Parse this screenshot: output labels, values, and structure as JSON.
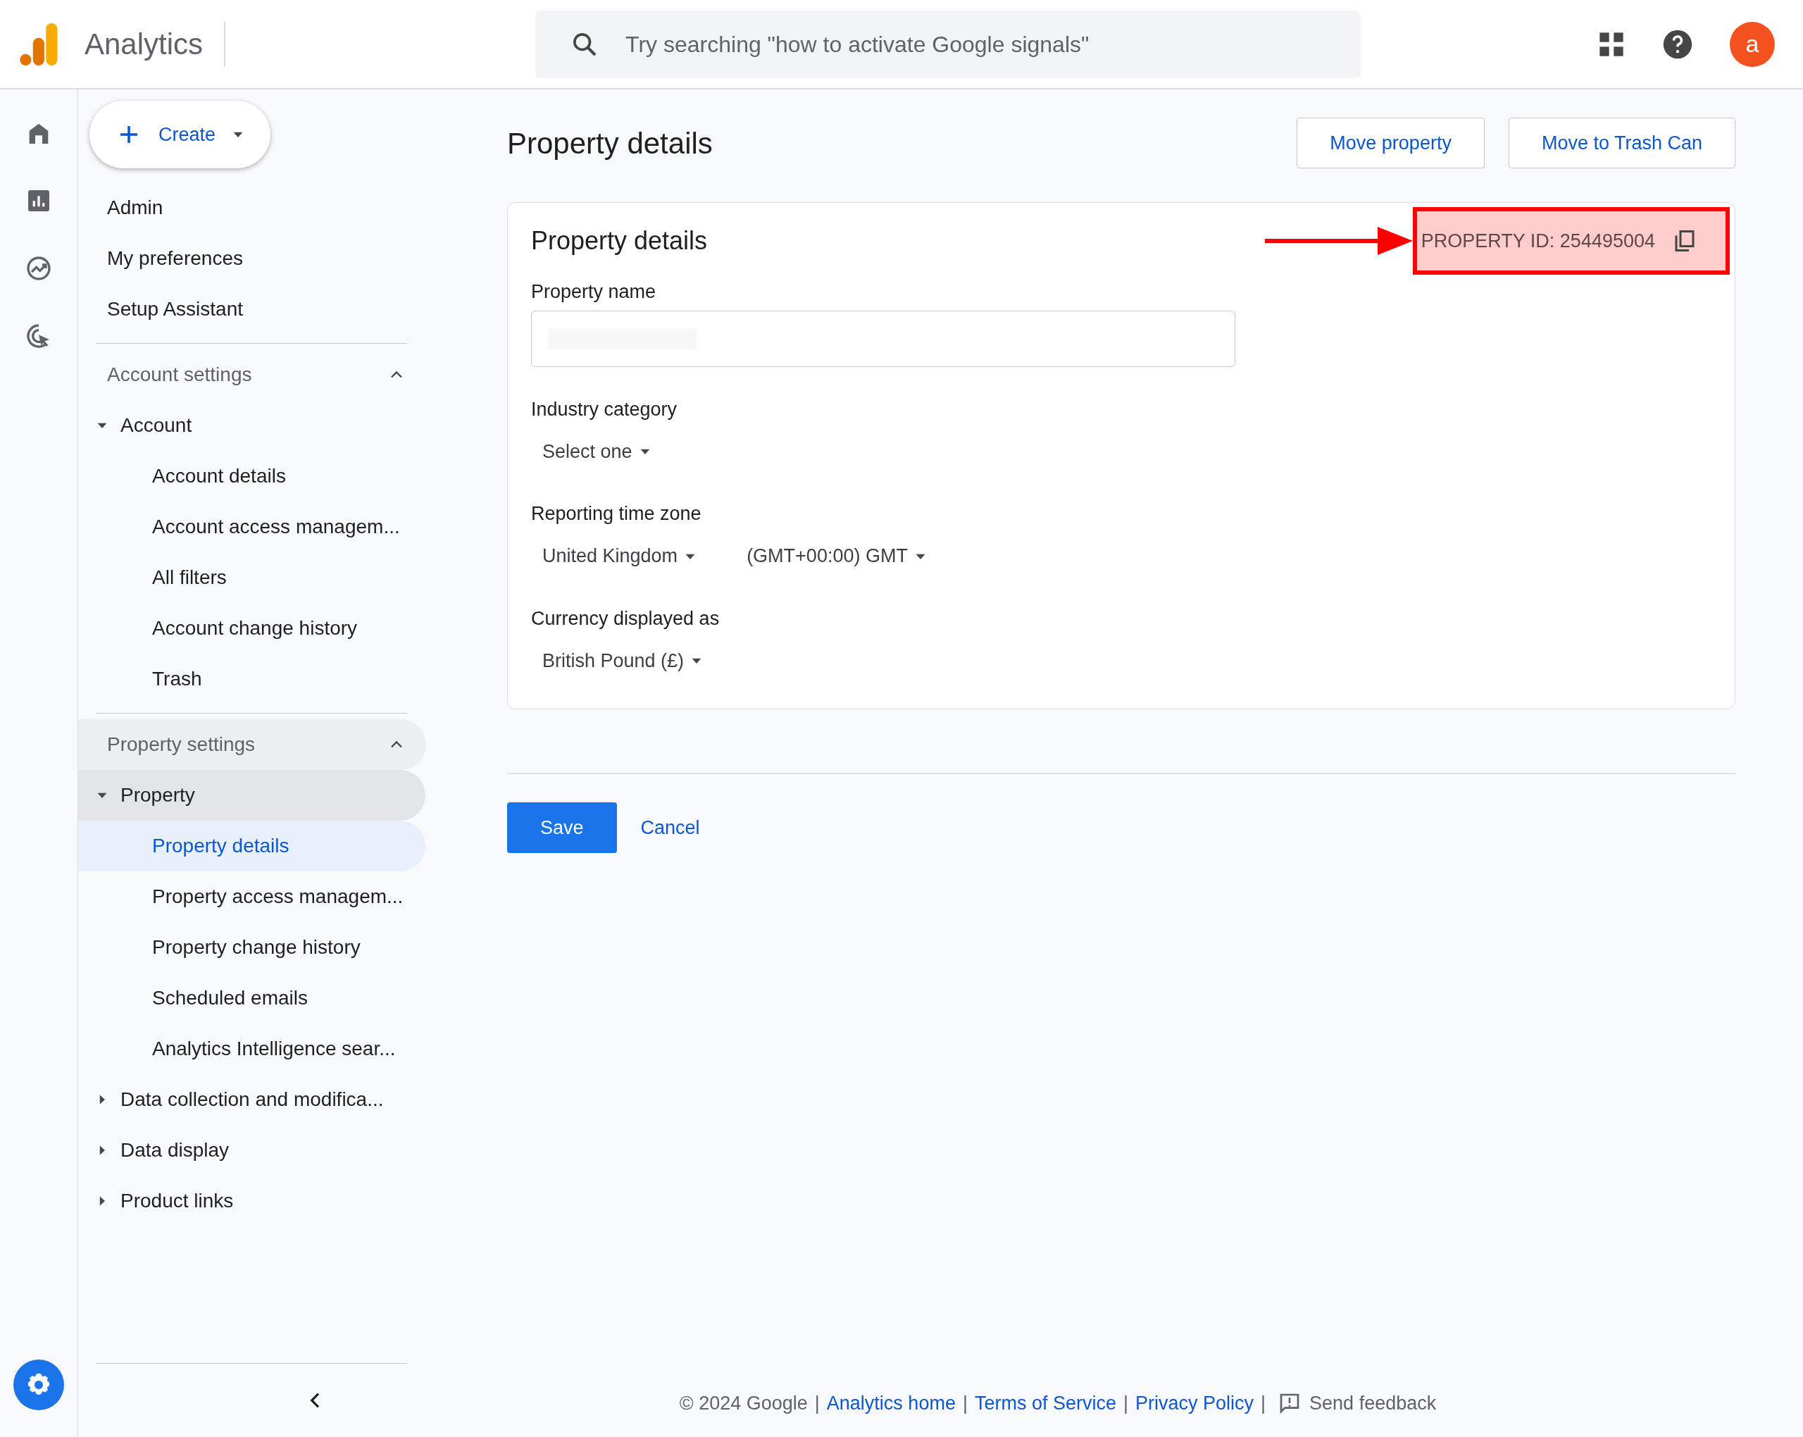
{
  "header": {
    "product": "Analytics",
    "search_placeholder": "Try searching \"how to activate Google signals\"",
    "avatar": "a"
  },
  "sidebar": {
    "create": "Create",
    "top_items": [
      "Admin",
      "My preferences",
      "Setup Assistant"
    ],
    "sections": [
      {
        "title": "Account settings",
        "expanded": true,
        "groups": [
          {
            "label": "Account",
            "expanded": true,
            "children": [
              {
                "label": "Account details",
                "selected": false
              },
              {
                "label": "Account access managem...",
                "selected": false
              },
              {
                "label": "All filters",
                "selected": false
              },
              {
                "label": "Account change history",
                "selected": false
              },
              {
                "label": "Trash",
                "selected": false
              }
            ]
          }
        ]
      },
      {
        "title": "Property settings",
        "expanded": true,
        "groups": [
          {
            "label": "Property",
            "expanded": true,
            "children": [
              {
                "label": "Property details",
                "selected": true
              },
              {
                "label": "Property access managem...",
                "selected": false
              },
              {
                "label": "Property change history",
                "selected": false
              },
              {
                "label": "Scheduled emails",
                "selected": false
              },
              {
                "label": "Analytics Intelligence sear...",
                "selected": false
              }
            ]
          },
          {
            "label": "Data collection and modifica...",
            "expanded": false
          },
          {
            "label": "Data display",
            "expanded": false
          },
          {
            "label": "Product links",
            "expanded": false
          }
        ]
      }
    ]
  },
  "page": {
    "title": "Property details",
    "actions": [
      "Move property",
      "Move to Trash Can"
    ],
    "card": {
      "title": "Property details",
      "property_id": "PROPERTY ID: 254495004",
      "fields": [
        {
          "kind": "text",
          "label": "Property name"
        },
        {
          "kind": "dropdowns",
          "label": "Industry category",
          "values": [
            "Select one"
          ]
        },
        {
          "kind": "dropdowns",
          "label": "Reporting time zone",
          "values": [
            "United Kingdom",
            "(GMT+00:00) GMT"
          ]
        },
        {
          "kind": "dropdowns",
          "label": "Currency displayed as",
          "values": [
            "British Pound (£)"
          ]
        }
      ]
    },
    "save": "Save",
    "cancel": "Cancel"
  },
  "footer": {
    "copyright": "© 2024 Google",
    "separator": "|",
    "links": [
      "Analytics home",
      "Terms of Service",
      "Privacy Policy"
    ],
    "feedback": "Send feedback"
  }
}
